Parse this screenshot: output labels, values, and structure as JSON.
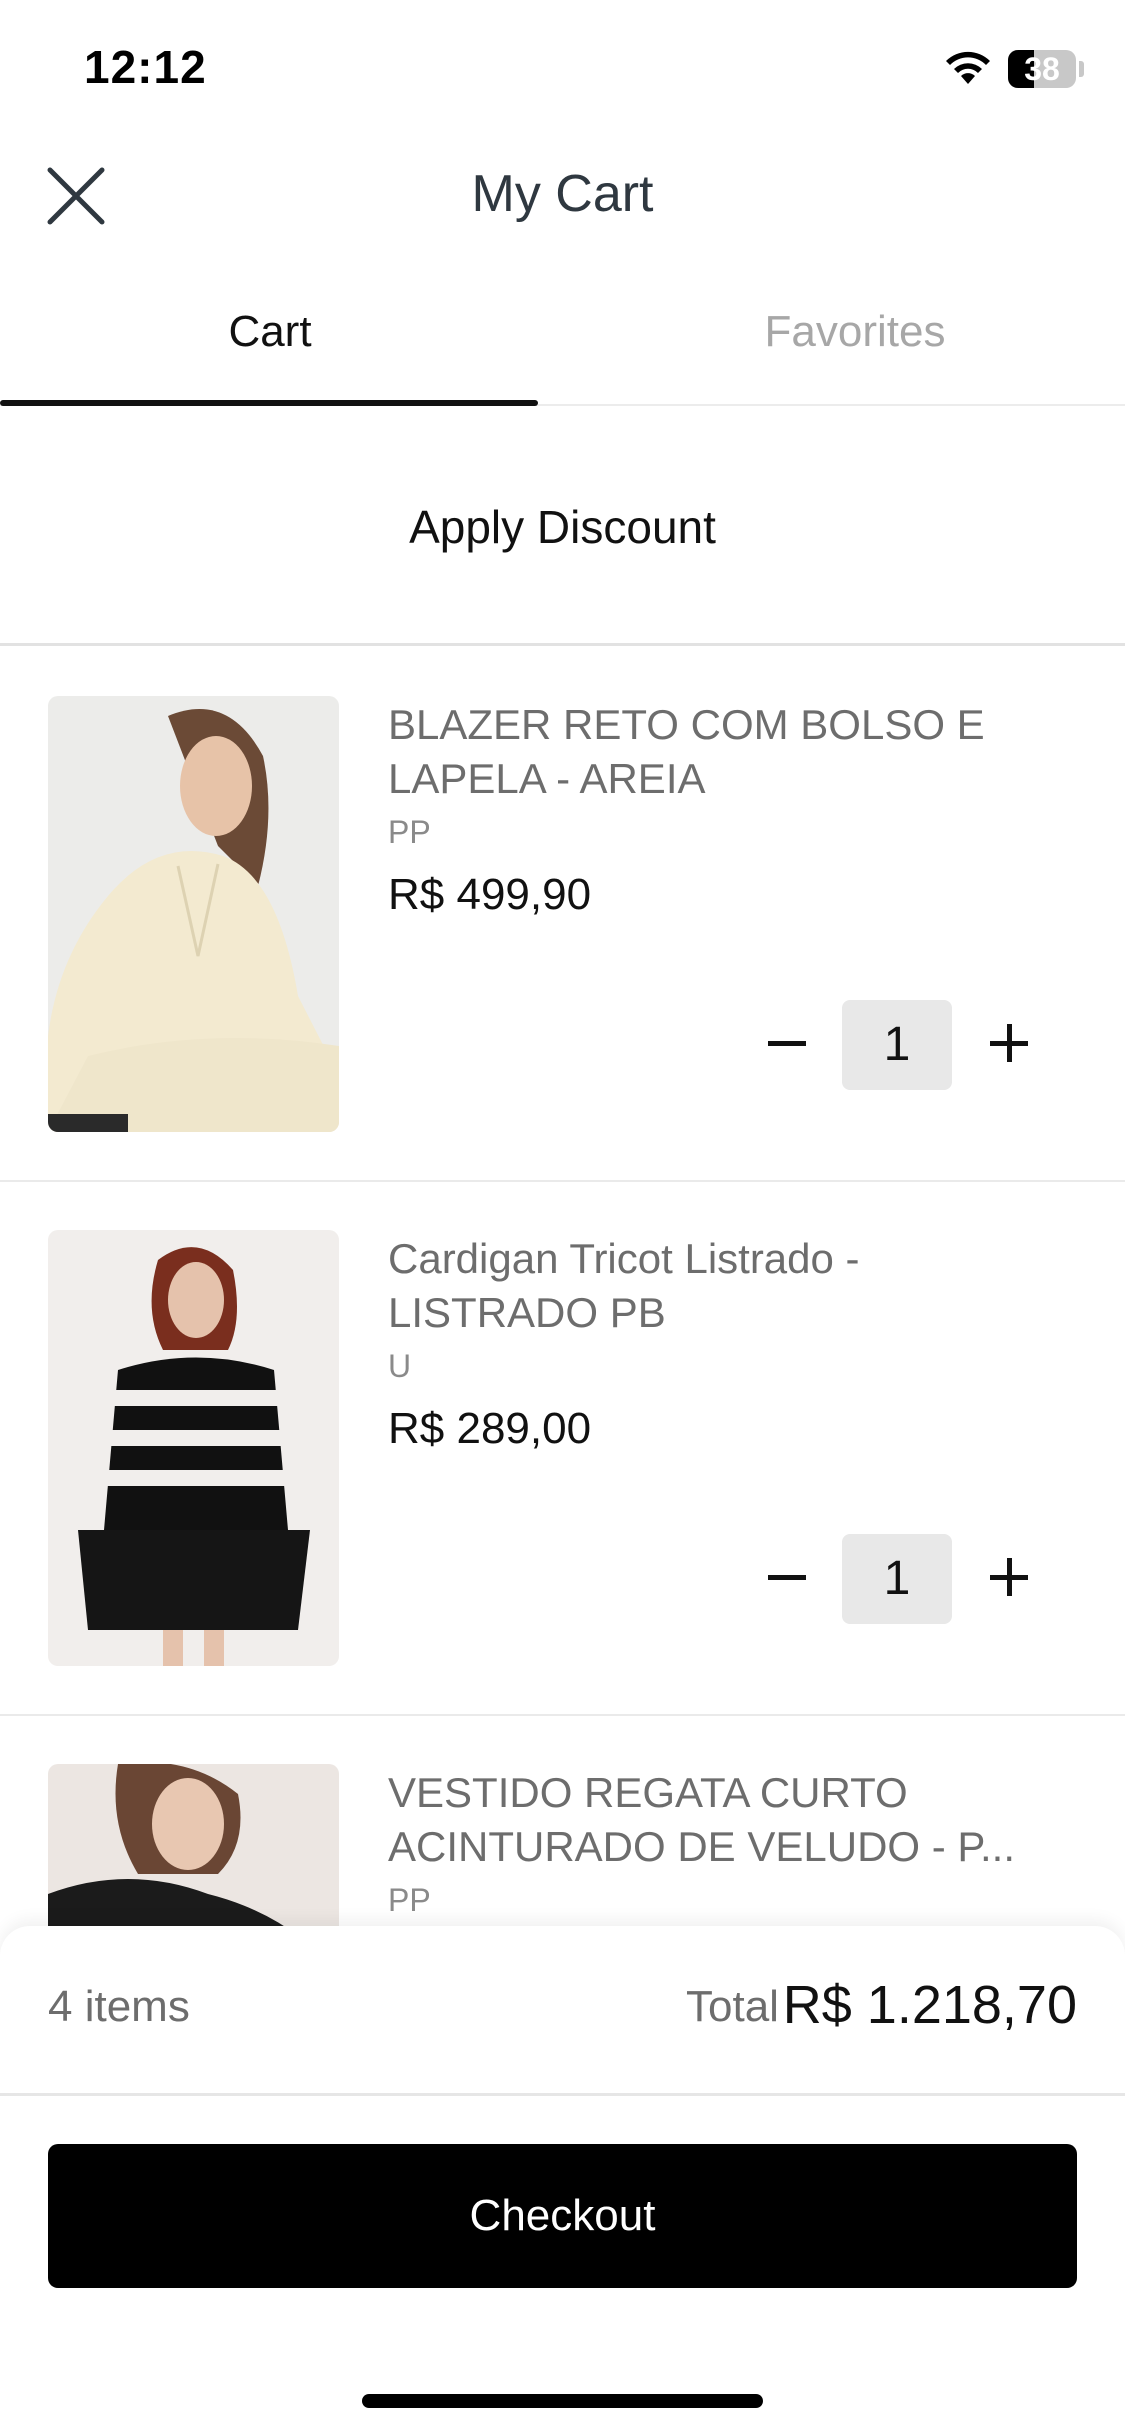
{
  "status_bar": {
    "time": "12:12",
    "battery_level": "38",
    "wifi_icon": "wifi-icon",
    "battery_icon": "battery-icon"
  },
  "header": {
    "title": "My Cart",
    "close_icon": "close-icon"
  },
  "tabs": [
    {
      "label": "Cart",
      "active": true
    },
    {
      "label": "Favorites",
      "active": false
    }
  ],
  "discount": {
    "label": "Apply Discount"
  },
  "items": [
    {
      "name": "BLAZER RETO COM BOLSO E LAPELA - AREIA",
      "size": "PP",
      "price": "R$ 499,90",
      "quantity": "1"
    },
    {
      "name": "Cardigan Tricot Listrado - LISTRADO PB",
      "size": "U",
      "price": "R$ 289,00",
      "quantity": "1"
    },
    {
      "name": "VESTIDO REGATA CURTO ACINTURADO DE VELUDO  - P...",
      "size": "PP",
      "price": "",
      "quantity": ""
    }
  ],
  "summary": {
    "items_count": "4 items",
    "total_label": "Total",
    "total_value": "R$ 1.218,70"
  },
  "checkout": {
    "label": "Checkout"
  },
  "colors": {
    "primary": "#000000",
    "muted_text": "#6d6d6d",
    "inactive_tab": "#a7a7a7",
    "qty_box": "#e8e8e8"
  }
}
